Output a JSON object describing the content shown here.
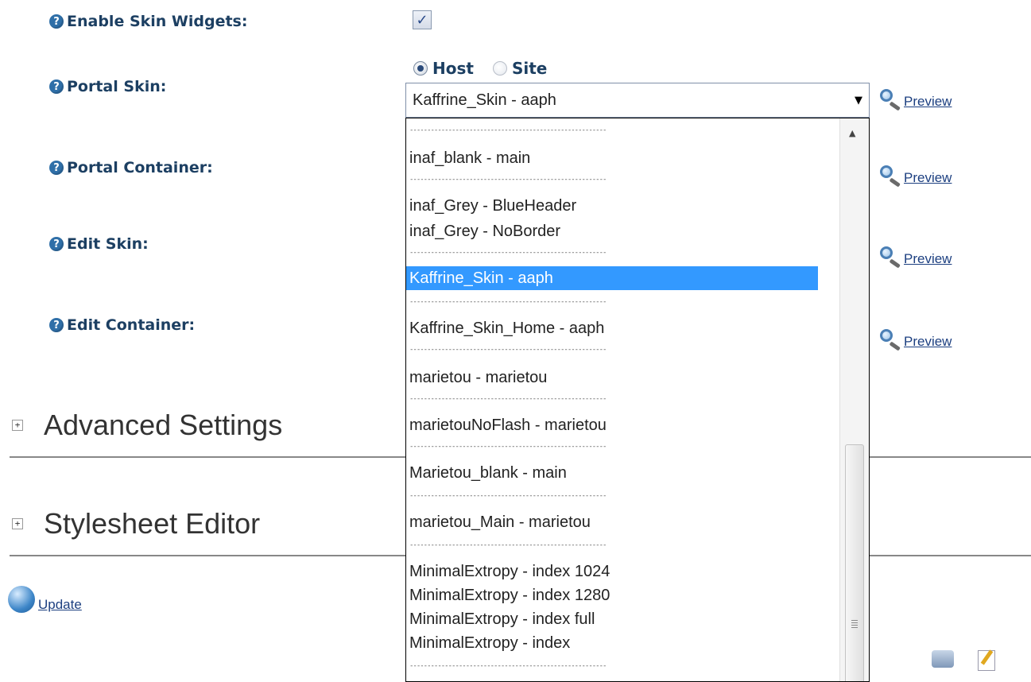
{
  "form": {
    "enable_widgets_label": "Enable Skin Widgets:",
    "enable_widgets_checked": true,
    "portal_skin_label": "Portal Skin:",
    "portal_container_label": "Portal Container:",
    "edit_skin_label": "Edit Skin:",
    "edit_container_label": "Edit Container:",
    "help_glyph": "?",
    "check_glyph": "✓",
    "radio_host": "Host",
    "radio_site": "Site",
    "radio_selected": "Host"
  },
  "select": {
    "value": "Kaffrine_Skin - aaph",
    "arrow": "▼"
  },
  "dropdown": {
    "separator": "--------------------------------------------------------",
    "options": [
      "inaf_blank - main",
      "inaf_Grey - BlueHeader",
      "inaf_Grey - NoBorder",
      "Kaffrine_Skin - aaph",
      "Kaffrine_Skin_Home - aaph",
      "marietou - marietou",
      "marietouNoFlash - marietou",
      "Marietou_blank - main",
      "marietou_Main - marietou",
      "MinimalExtropy - index 1024",
      "MinimalExtropy - index 1280",
      "MinimalExtropy - index full",
      "MinimalExtropy - index"
    ],
    "selected_index": 3,
    "scroll_up": "▲"
  },
  "preview_label": "Preview",
  "sections": {
    "advanced": "Advanced Settings",
    "stylesheet": "Stylesheet Editor",
    "expand_glyph": "+"
  },
  "update_label": "Update",
  "icons": {
    "help": "help-icon",
    "preview": "magnifier-icon",
    "update": "update-icon",
    "print": "print-icon",
    "edit": "edit-icon"
  }
}
